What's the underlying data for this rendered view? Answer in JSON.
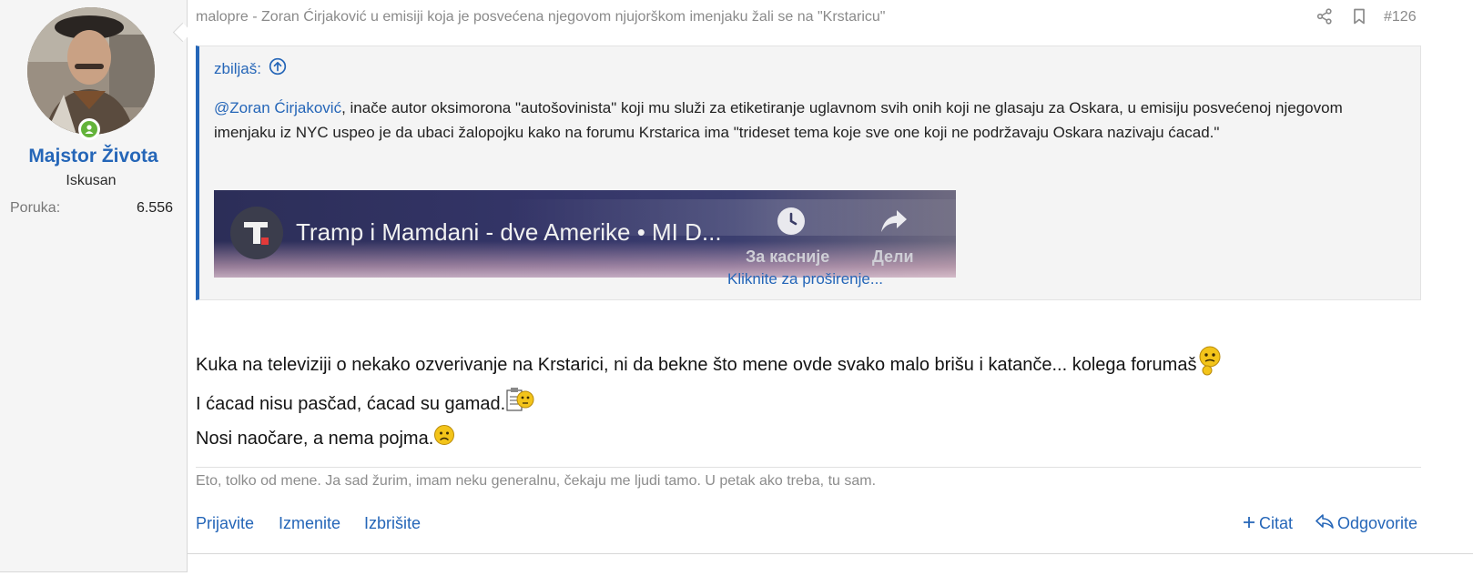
{
  "user": {
    "name": "Majstor Života",
    "title": "Iskusan",
    "stat_label": "Poruka:",
    "stat_value": "6.556"
  },
  "header": {
    "title": "malopre - Zoran Ćirjaković u emisiji koja je posvećena njegovom njujorškom imenjaku žali se na \"Krstaricu\"",
    "post_number": "#126"
  },
  "quote": {
    "author": "zbiljaš:",
    "mention": "@Zoran Ćirjaković",
    "text": ", inače autor oksimorona \"autošovinista\" koji mu služi za etiketiranje uglavnom svih onih koji ne glasaju za Oskara, u emisiju posvećenoj njegovom imenjaku iz NYC uspeo je da ubaci žalopojku kako na forumu Krstarica ima \"trideset tema koje sve one koji ne podržavaju Oskara nazivaju ćacad.\"",
    "embed": {
      "title": "Tramp i Mamdani - dve Amerike • MI D...",
      "watch_later": "За касније",
      "share": "Дели"
    },
    "expand_label": "Kliknite za proširenje..."
  },
  "body": {
    "line1": "Kuka na televiziji o nekako ozverivanje na Krstarici, ni da bekne što mene ovde svako malo brišu i katanče... kolega forumaš",
    "line2": "I ćacad nisu pasčad, ćacad su gamad.",
    "line3": "Nosi naočare, a nema pojma."
  },
  "signature": "Eto, tolko od mene. Ja sad žurim, imam neku generalnu, čekaju me ljudi tamo. U petak ako treba, tu sam.",
  "footer": {
    "report": "Prijavite",
    "edit": "Izmenite",
    "delete": "Izbrišite",
    "quote": "Citat",
    "reply": "Odgovorite"
  },
  "colors": {
    "link": "#2566b8",
    "online": "#63b33a"
  },
  "icons": [
    "share-icon",
    "bookmark-icon",
    "arrow-up-circle-icon",
    "clock-icon",
    "share-arrow-icon",
    "plus-icon",
    "reply-icon",
    "emoji-thinking-icon",
    "emoji-clipboard-icon",
    "emoji-sad-icon"
  ]
}
